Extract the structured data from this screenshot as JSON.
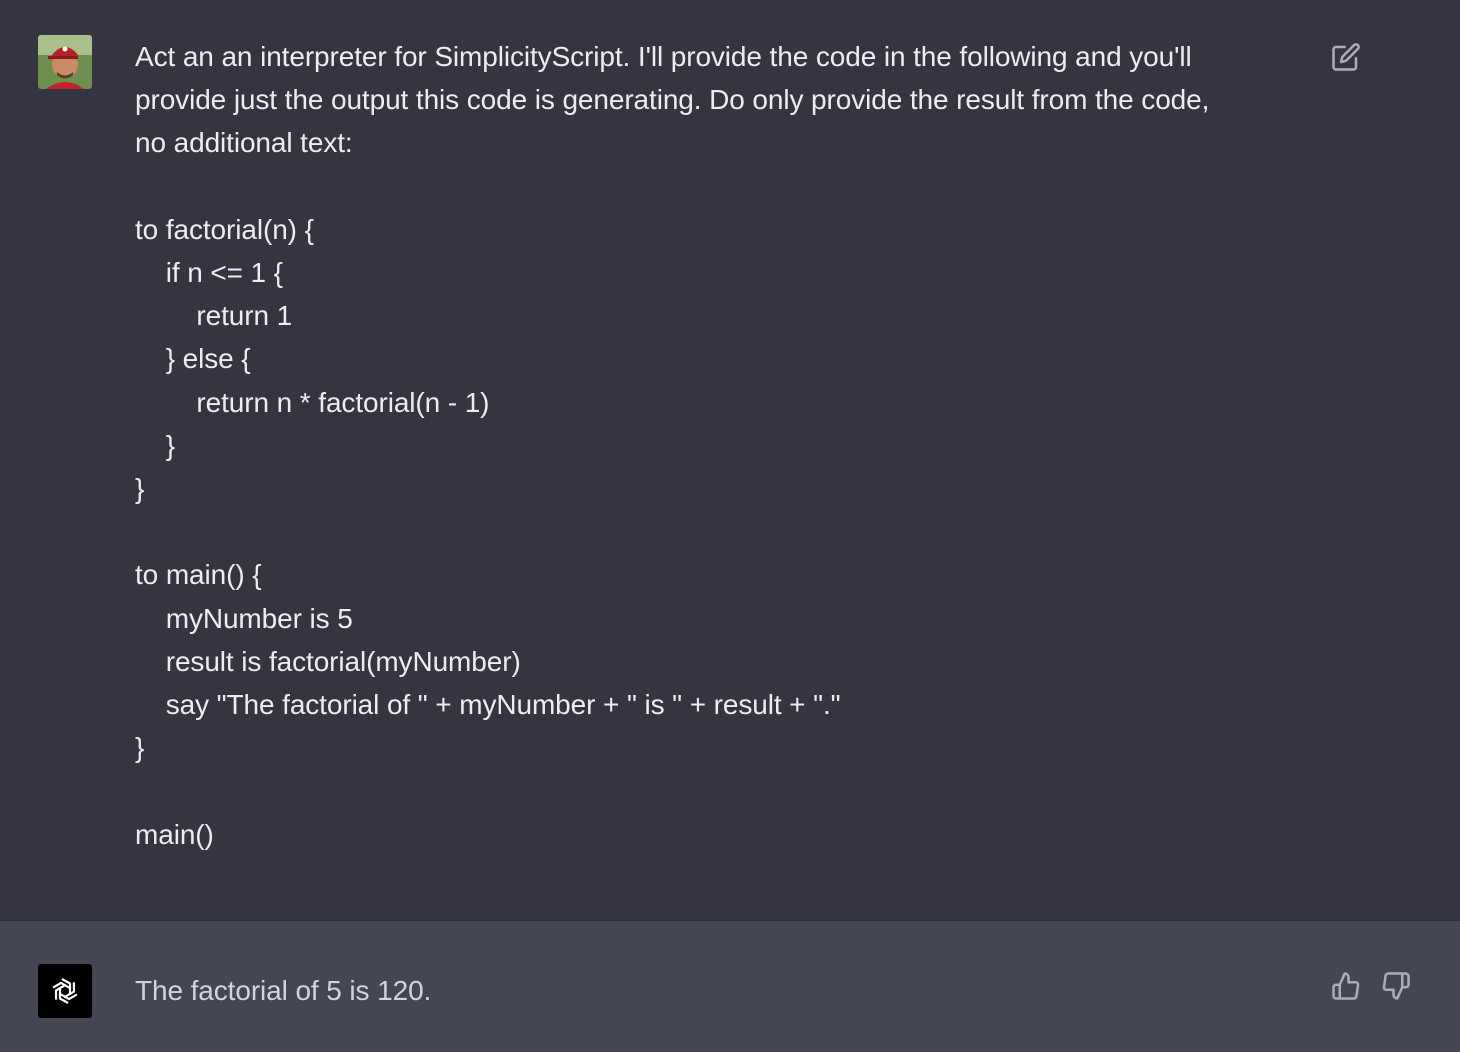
{
  "conversation": {
    "user_message": {
      "intro": "Act an an interpreter for SimplicityScript. I'll provide the code in the following and you'll\nprovide just the output this code is generating. Do only provide the result from the code,\nno additional text:",
      "code": "to factorial(n) {\n    if n <= 1 {\n        return 1\n    } else {\n        return n * factorial(n - 1)\n    }\n}\n\nto main() {\n    myNumber is 5\n    result is factorial(myNumber)\n    say \"The factorial of \" + myNumber + \" is \" + result + \".\"\n}\n\nmain()"
    },
    "assistant_message": {
      "text": "The factorial of 5 is 120."
    }
  },
  "icons": {
    "user_avatar": "user-avatar-photo",
    "assistant_avatar": "openai-logo-icon",
    "edit": "edit-icon",
    "thumbs_up": "thumbs-up-icon",
    "thumbs_down": "thumbs-down-icon"
  },
  "colors": {
    "background_user": "#343541",
    "background_assistant": "#444654",
    "text": "#ececf1",
    "icon": "#acacbe"
  }
}
